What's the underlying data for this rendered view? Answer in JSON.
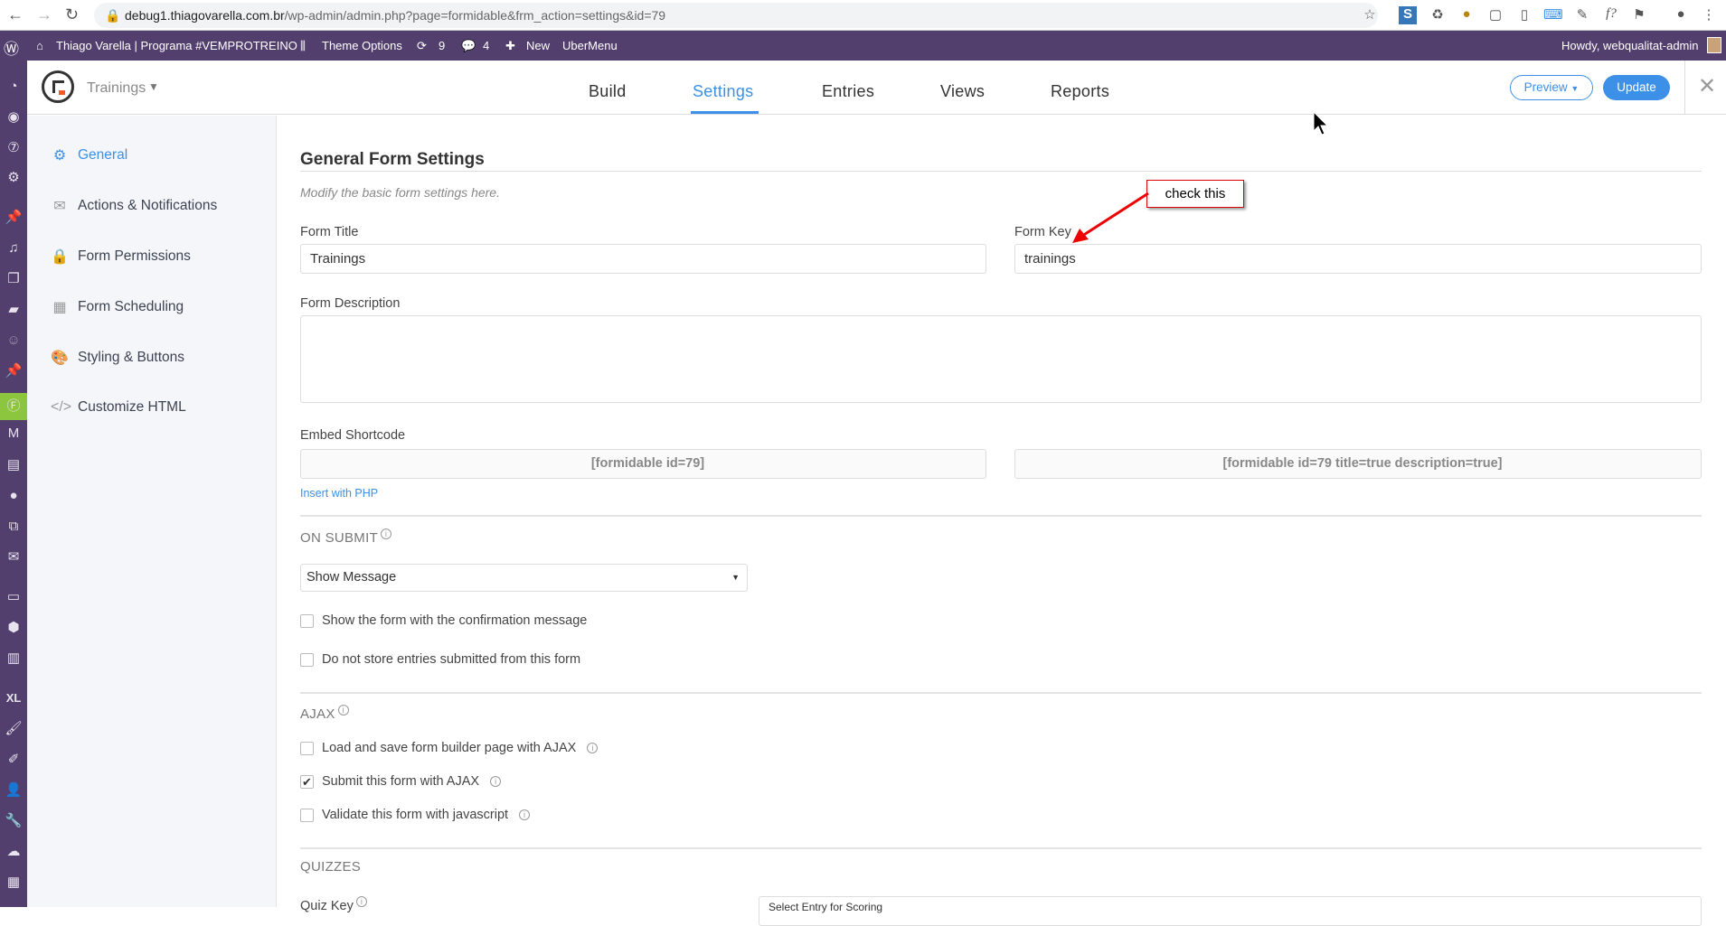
{
  "browser": {
    "url_host": "debug1.thiagovarella.com.br",
    "url_path": "/wp-admin/admin.php?page=formidable&frm_action=settings&id=79"
  },
  "adminbar": {
    "site": "Thiago Varella | Programa #VEMPROTREINO",
    "theme_options": "Theme Options",
    "updates": "9",
    "comments": "4",
    "new": "New",
    "ubermenu": "UberMenu",
    "howdy": "Howdy, webqualitat-admin"
  },
  "header": {
    "form_name": "Trainings",
    "tabs": [
      "Build",
      "Settings",
      "Entries",
      "Views",
      "Reports"
    ],
    "preview": "Preview",
    "update": "Update"
  },
  "sidebar": {
    "items": [
      "General",
      "Actions & Notifications",
      "Form Permissions",
      "Form Scheduling",
      "Styling & Buttons",
      "Customize HTML"
    ]
  },
  "main": {
    "title": "General Form Settings",
    "subtitle": "Modify the basic form settings here.",
    "form_title_label": "Form Title",
    "form_title_value": "Trainings",
    "form_key_label": "Form Key",
    "form_key_value": "trainings",
    "form_desc_label": "Form Description",
    "embed_label": "Embed Shortcode",
    "shortcode1": "[formidable id=79]",
    "shortcode2": "[formidable id=79 title=true description=true]",
    "insert_php": "Insert with PHP",
    "on_submit": "ON SUBMIT",
    "on_submit_select": "Show Message",
    "chk_show_form": "Show the form with the confirmation message",
    "chk_no_store": "Do not store entries submitted from this form",
    "ajax": "AJAX",
    "chk_ajax_builder": "Load and save form builder page with AJAX",
    "chk_ajax_submit": "Submit this form with AJAX",
    "chk_validate_js": "Validate this form with javascript",
    "quizzes": "QUIZZES",
    "quiz_key": "Quiz Key",
    "quiz_select": "Select Entry for Scoring"
  },
  "annotation": {
    "callout": "check this"
  },
  "checkbox_states": {
    "ajax_submit": true,
    "ajax_builder": false,
    "validate_js": false,
    "show_form": false,
    "no_store": false
  }
}
